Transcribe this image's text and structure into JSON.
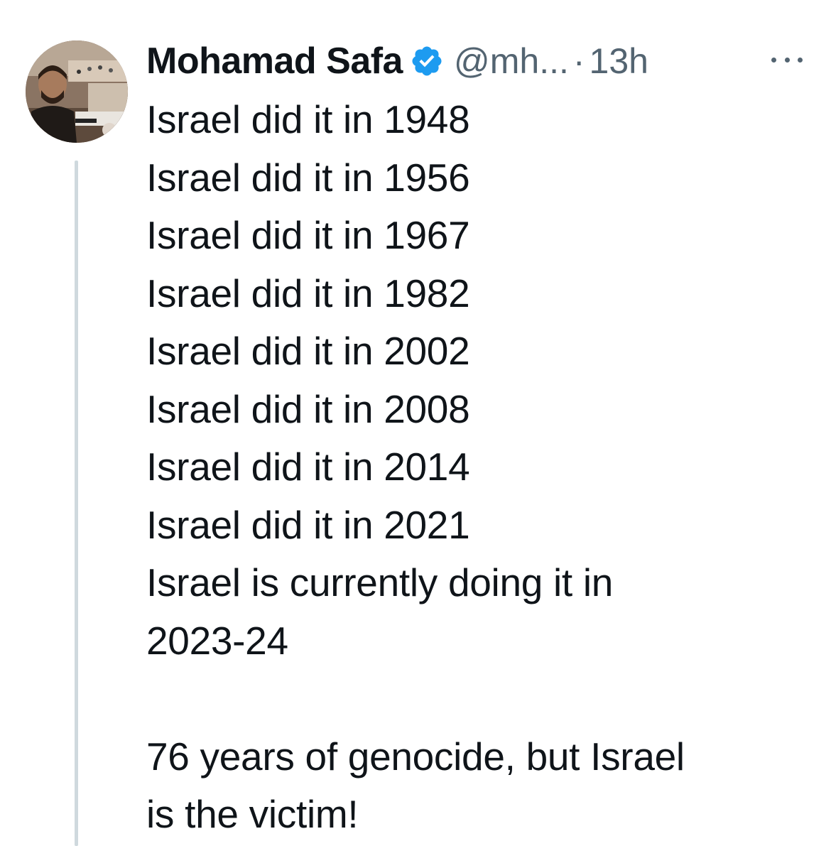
{
  "tweet": {
    "author_name": "Mohamad Safa",
    "handle": "@mh...",
    "separator": "·",
    "time": "13h",
    "verified_color": "#1d9bf0",
    "text": "Israel did it in 1948\nIsrael did it in 1956\nIsrael did it in 1967\nIsrael did it in 1982\nIsrael did it in 2002\nIsrael did it in 2008\nIsrael did it in 2014\nIsrael did it in 2021\nIsrael is currently doing it in\n2023-24\n\n76 years of genocide, but Israel\nis the victim!",
    "more_icon": "more-horizontal-icon",
    "verified_icon": "verified-badge-icon"
  }
}
